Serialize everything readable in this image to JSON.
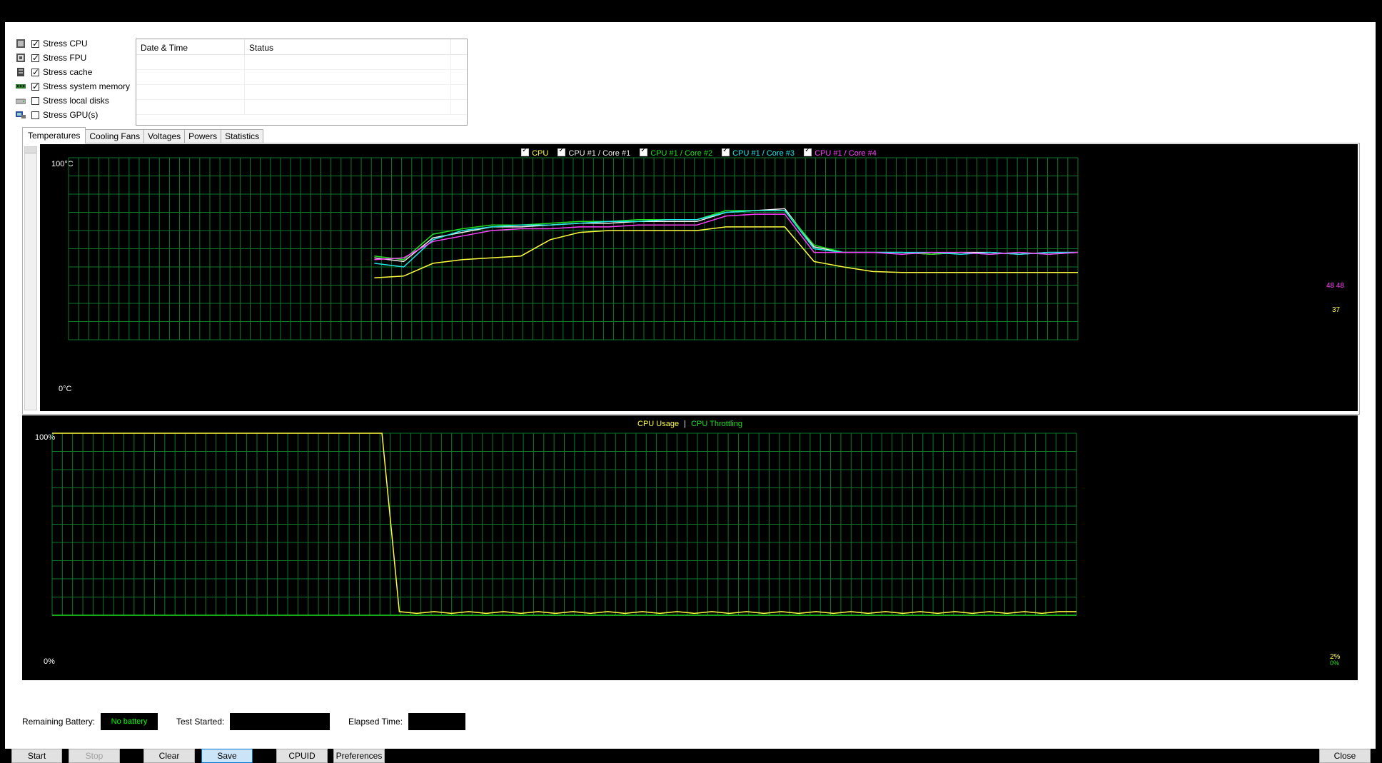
{
  "stress_options": [
    {
      "label": "Stress CPU",
      "checked": true,
      "icon": "cpu-chip-icon"
    },
    {
      "label": "Stress FPU",
      "checked": true,
      "icon": "fpu-chip-icon"
    },
    {
      "label": "Stress cache",
      "checked": true,
      "icon": "cache-chip-icon"
    },
    {
      "label": "Stress system memory",
      "checked": true,
      "icon": "memory-module-icon"
    },
    {
      "label": "Stress local disks",
      "checked": false,
      "icon": "disk-drive-icon"
    },
    {
      "label": "Stress GPU(s)",
      "checked": false,
      "icon": "gpu-card-icon"
    }
  ],
  "log": {
    "col_datetime": "Date & Time",
    "col_status": "Status"
  },
  "tabs": [
    "Temperatures",
    "Cooling Fans",
    "Voltages",
    "Powers",
    "Statistics"
  ],
  "active_tab": "Temperatures",
  "colors": {
    "yellow": "#ffff40",
    "white": "#f0f0f0",
    "green": "#20e020",
    "cyan": "#20e8e8",
    "magenta": "#ff40ff",
    "grid": "#0d7a2a",
    "field_green": "#00ff00"
  },
  "chart_data": [
    {
      "type": "line",
      "legend": [
        "CPU",
        "CPU #1 / Core #1",
        "CPU #1 / Core #2",
        "CPU #1 / Core #3",
        "CPU #1 / Core #4"
      ],
      "y_top": "100°C",
      "y_bottom": "0°C",
      "ylim": [
        0,
        100
      ],
      "end_labels": {
        "cores": "48 48",
        "cpu": "37"
      },
      "series": [
        {
          "name": "CPU",
          "values": [
            34,
            35,
            42,
            44,
            45,
            46,
            55,
            59,
            60,
            60,
            60,
            60,
            62,
            62,
            62,
            43,
            40,
            37.5,
            37,
            37,
            37,
            37,
            37,
            37,
            37
          ]
        },
        {
          "name": "CPU #1 / Core #1",
          "values": [
            45,
            43,
            56,
            59,
            62,
            62,
            63,
            64,
            64,
            65,
            65,
            65,
            70,
            71,
            72,
            51,
            48,
            48,
            48,
            47,
            48,
            48,
            47,
            48,
            48
          ]
        },
        {
          "name": "CPU #1 / Core #2",
          "values": [
            46,
            44,
            58,
            61,
            63,
            63,
            64,
            65,
            65,
            66,
            66,
            66,
            71,
            71,
            71,
            52,
            48,
            48,
            48,
            47,
            48,
            47,
            48,
            47,
            48
          ]
        },
        {
          "name": "CPU #1 / Core #3",
          "values": [
            42,
            40,
            55,
            60,
            62,
            63,
            63,
            64,
            65,
            65,
            66,
            66,
            70,
            71,
            71,
            50,
            48,
            48,
            48,
            48,
            47,
            48,
            47,
            48,
            48
          ]
        },
        {
          "name": "CPU #1 / Core #4",
          "values": [
            44,
            45,
            54,
            57,
            60,
            61,
            61,
            62,
            62,
            63,
            63,
            63,
            68,
            69,
            69,
            48,
            48,
            48,
            47,
            48,
            48,
            47,
            48,
            47,
            48
          ]
        }
      ]
    },
    {
      "type": "line",
      "legend": [
        "CPU Usage",
        "CPU Throttling"
      ],
      "legend_separator": "|",
      "y_top": "100%",
      "y_bottom": "0%",
      "ylim": [
        0,
        100
      ],
      "end_labels": {
        "usage": "2%",
        "throttling": "0%"
      },
      "series": [
        {
          "name": "CPU Usage",
          "values": [
            100,
            100,
            100,
            100,
            100,
            100,
            100,
            100,
            100,
            100,
            100,
            100,
            100,
            100,
            100,
            100,
            100,
            100,
            100,
            100,
            2,
            1,
            2,
            1,
            2,
            1,
            2,
            1,
            2,
            1,
            2,
            1,
            2,
            1,
            2,
            1,
            2,
            1,
            2,
            1,
            2,
            1,
            2,
            1,
            2,
            1,
            2,
            1,
            2,
            1,
            2,
            1,
            2,
            1,
            2,
            1,
            2,
            1,
            2,
            2
          ]
        },
        {
          "name": "CPU Throttling",
          "values": [
            0,
            0,
            0,
            0,
            0,
            0,
            0,
            0,
            0,
            0,
            0,
            0,
            0,
            0,
            0,
            0,
            0,
            0,
            0,
            0,
            0,
            0,
            0,
            0,
            0,
            0,
            0,
            0,
            0,
            0,
            0,
            0,
            0,
            0,
            0,
            0,
            0,
            0,
            0,
            0,
            0,
            0,
            0,
            0,
            0,
            0,
            0,
            0,
            0,
            0,
            0,
            0,
            0,
            0,
            0,
            0,
            0,
            0,
            0,
            0
          ]
        }
      ]
    }
  ],
  "status": {
    "battery_label": "Remaining Battery:",
    "battery_value": "No battery",
    "test_started_label": "Test Started:",
    "test_started_value": "",
    "elapsed_label": "Elapsed Time:",
    "elapsed_value": ""
  },
  "buttons": {
    "start": "Start",
    "stop": "Stop",
    "clear": "Clear",
    "save": "Save",
    "cpuid": "CPUID",
    "preferences": "Preferences",
    "close": "Close"
  }
}
